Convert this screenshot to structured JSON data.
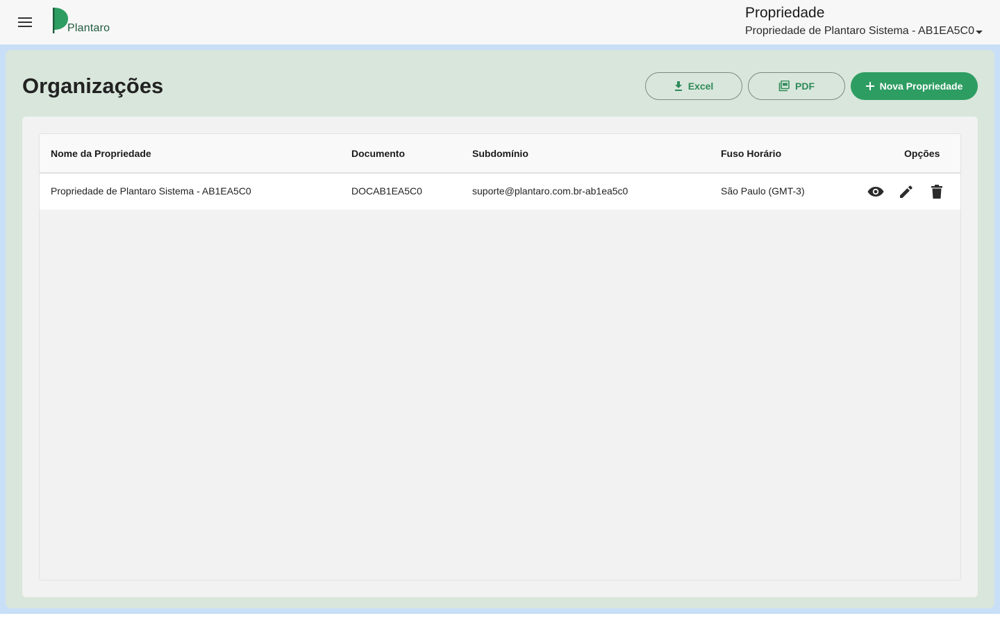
{
  "header": {
    "logo_text": "Plantaro",
    "context_label": "Propriedade",
    "selected_property": "Propriedade de Plantaro Sistema - AB1EA5C0"
  },
  "page": {
    "title": "Organizações"
  },
  "actions": {
    "excel_label": "Excel",
    "pdf_label": "PDF",
    "new_label": "Nova Propriedade"
  },
  "table": {
    "columns": [
      "Nome da Propriedade",
      "Documento",
      "Subdomínio",
      "Fuso Horário",
      "Opções"
    ],
    "rows": [
      {
        "name": "Propriedade de Plantaro Sistema - AB1EA5C0",
        "document": "DOCAB1EA5C0",
        "subdomain": "suporte@plantaro.com.br-ab1ea5c0",
        "timezone": "São Paulo (GMT-3)"
      }
    ]
  },
  "icons": {
    "menu": "menu-icon",
    "download": "download-icon",
    "pdf": "pdf-icon",
    "add": "plus-icon",
    "view": "eye-icon",
    "edit": "pencil-icon",
    "delete": "trash-icon"
  },
  "colors": {
    "primary": "#2e9d62",
    "outline_text": "#2e8b5a",
    "panel_bg": "#d9e6db",
    "outer_bg": "#c9dff7",
    "logo_green": "#1e5b3c"
  }
}
